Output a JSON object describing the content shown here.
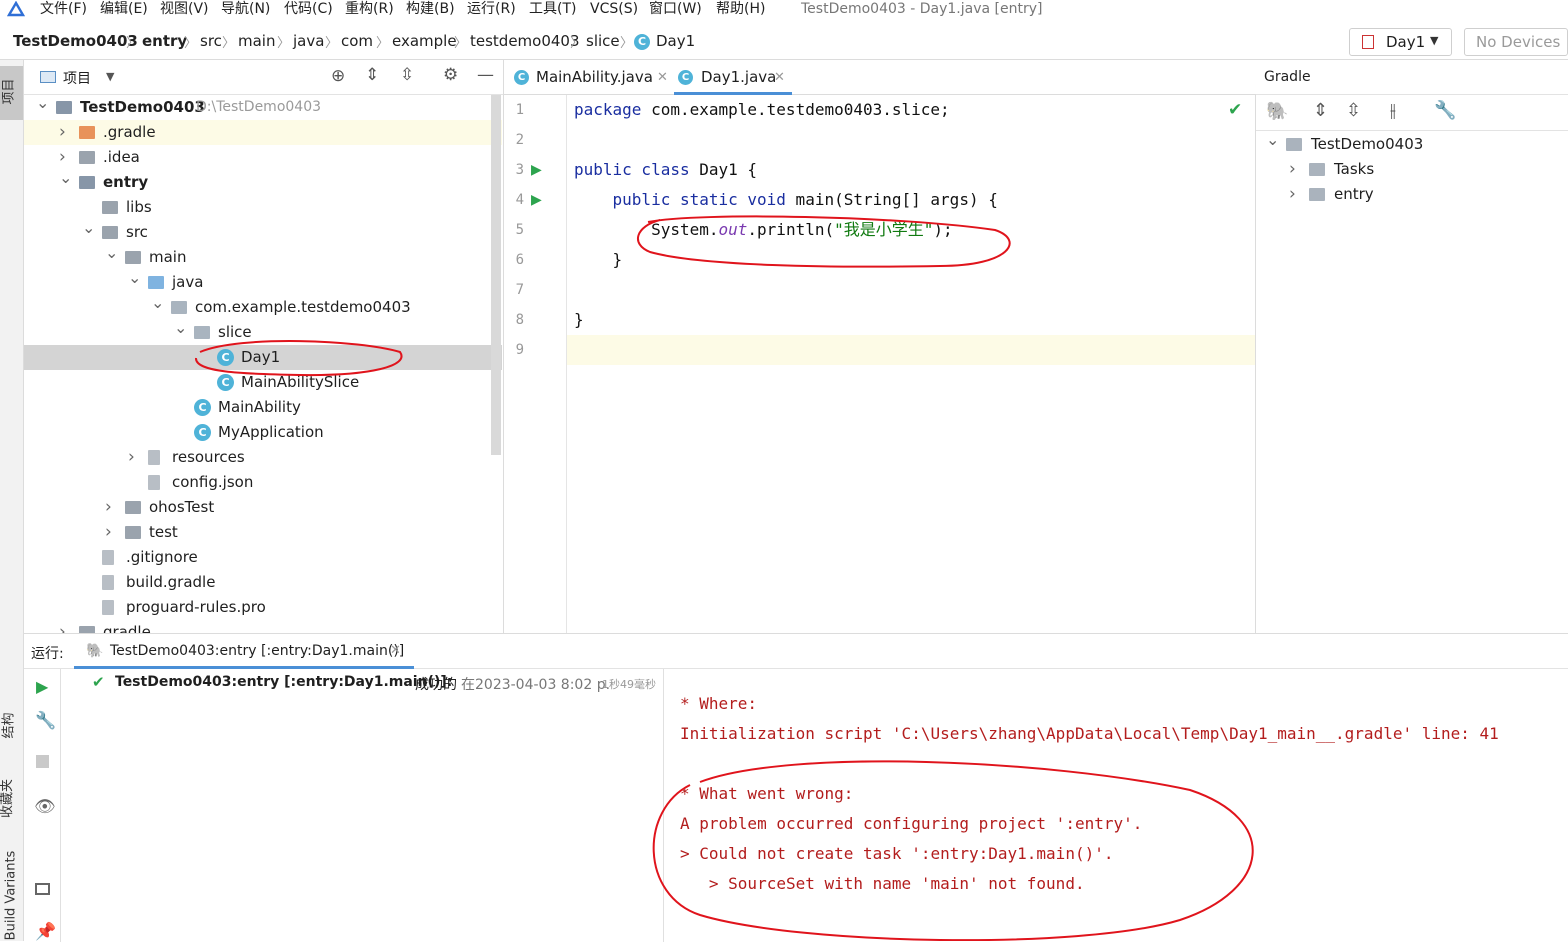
{
  "menu": {
    "items": [
      "文件(F)",
      "编辑(E)",
      "视图(V)",
      "导航(N)",
      "代码(C)",
      "重构(R)",
      "构建(B)",
      "运行(R)",
      "工具(T)",
      "VCS(S)",
      "窗口(W)",
      "帮助(H)"
    ],
    "window_title": "TestDemo0403 - Day1.java [entry]"
  },
  "breadcrumb": [
    "TestDemo0403",
    "entry",
    "src",
    "main",
    "java",
    "com",
    "example",
    "testdemo0403",
    "slice",
    "Day1"
  ],
  "toolbar": {
    "run_config": "Day1",
    "devices": "No Devices"
  },
  "sidebar": {
    "project_label": "项目",
    "structure_label": "结构",
    "favorites_label": "收藏夹",
    "build_variants_label": "Build Variants"
  },
  "project": {
    "title": "项目",
    "tree": [
      {
        "label": "TestDemo0403",
        "path": "D:\\TestDemo0403",
        "depth": 0,
        "expanded": true,
        "kind": "module",
        "bold": true
      },
      {
        "label": ".gradle",
        "depth": 1,
        "expanded": false,
        "kind": "folder-orange",
        "highlight": true
      },
      {
        "label": ".idea",
        "depth": 1,
        "expanded": false,
        "kind": "folder"
      },
      {
        "label": "entry",
        "depth": 1,
        "expanded": true,
        "kind": "module",
        "bold": true
      },
      {
        "label": "libs",
        "depth": 2,
        "kind": "folder"
      },
      {
        "label": "src",
        "depth": 2,
        "expanded": true,
        "kind": "folder"
      },
      {
        "label": "main",
        "depth": 3,
        "expanded": true,
        "kind": "folder"
      },
      {
        "label": "java",
        "depth": 4,
        "expanded": true,
        "kind": "folder-blue"
      },
      {
        "label": "com.example.testdemo0403",
        "depth": 5,
        "expanded": true,
        "kind": "package"
      },
      {
        "label": "slice",
        "depth": 6,
        "expanded": true,
        "kind": "package"
      },
      {
        "label": "Day1",
        "depth": 7,
        "kind": "class-run",
        "selected": true
      },
      {
        "label": "MainAbilitySlice",
        "depth": 7,
        "kind": "class"
      },
      {
        "label": "MainAbility",
        "depth": 6,
        "kind": "class"
      },
      {
        "label": "MyApplication",
        "depth": 6,
        "kind": "class"
      },
      {
        "label": "resources",
        "depth": 4,
        "expanded": false,
        "kind": "folder-res"
      },
      {
        "label": "config.json",
        "depth": 4,
        "kind": "json"
      },
      {
        "label": "ohosTest",
        "depth": 3,
        "expanded": false,
        "kind": "folder"
      },
      {
        "label": "test",
        "depth": 3,
        "expanded": false,
        "kind": "folder"
      },
      {
        "label": ".gitignore",
        "depth": 2,
        "kind": "file"
      },
      {
        "label": "build.gradle",
        "depth": 2,
        "kind": "gradle"
      },
      {
        "label": "proguard-rules.pro",
        "depth": 2,
        "kind": "file"
      },
      {
        "label": "gradle",
        "depth": 1,
        "expanded": false,
        "kind": "folder"
      }
    ]
  },
  "editor": {
    "tabs": [
      {
        "label": "MainAbility.java",
        "active": false
      },
      {
        "label": "Day1.java",
        "active": true
      }
    ],
    "lines": [
      {
        "n": "1",
        "parts": [
          [
            "kw",
            "package"
          ],
          [
            "t",
            " com.example.testdemo0403.slice;"
          ]
        ]
      },
      {
        "n": "2",
        "parts": []
      },
      {
        "n": "3",
        "parts": [
          [
            "kw",
            "public class"
          ],
          [
            "t",
            " Day1 {"
          ]
        ]
      },
      {
        "n": "4",
        "parts": [
          [
            "t",
            "    "
          ],
          [
            "kw",
            "public static void"
          ],
          [
            "t",
            " main(String[] args) {"
          ]
        ]
      },
      {
        "n": "5",
        "parts": [
          [
            "t",
            "        System."
          ],
          [
            "fld",
            "out"
          ],
          [
            "t",
            ".println("
          ],
          [
            "str",
            "\"我是小学生\""
          ],
          [
            "t",
            ");"
          ]
        ]
      },
      {
        "n": "6",
        "parts": [
          [
            "t",
            "    }"
          ]
        ]
      },
      {
        "n": "7",
        "parts": []
      },
      {
        "n": "8",
        "parts": [
          [
            "t",
            "}"
          ]
        ]
      },
      {
        "n": "9",
        "parts": []
      }
    ]
  },
  "gradle": {
    "title": "Gradle",
    "tree": [
      {
        "label": "TestDemo0403",
        "depth": 0,
        "expanded": true
      },
      {
        "label": "Tasks",
        "depth": 1,
        "expanded": false
      },
      {
        "label": "entry",
        "depth": 1,
        "expanded": false
      }
    ]
  },
  "run": {
    "label": "运行:",
    "tab": "TestDemo0403:entry [:entry:Day1.main()]",
    "status_title": "TestDemo0403:entry [:entry:Day1.main()]:",
    "status_result": "成功的",
    "status_time": "在2023-04-03 8:02 p.",
    "status_duration": "1秒49毫秒",
    "output": [
      "* Where:",
      "Initialization script 'C:\\Users\\zhang\\AppData\\Local\\Temp\\Day1_main__.gradle' line: 41",
      "",
      "* What went wrong:",
      "A problem occurred configuring project ':entry'.",
      "> Could not create task ':entry:Day1.main()'.",
      "   > SourceSet with name 'main' not found."
    ]
  },
  "colors": {
    "accent": "#4fb3d8",
    "selection": "#d4d4d4",
    "highlight": "#fdfbe6",
    "error": "#b31d1d",
    "annotation": "#e0141c"
  }
}
